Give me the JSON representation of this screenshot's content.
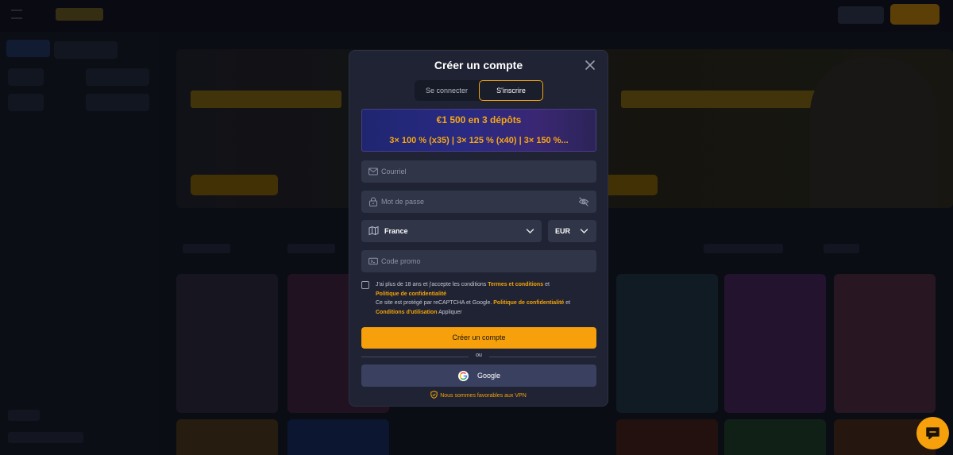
{
  "modal": {
    "title": "Créer un compte",
    "tabs": {
      "login": "Se connecter",
      "register": "S'inscrire",
      "active": "register"
    },
    "promo": {
      "line1": "€1 500 en 3 dépôts",
      "line2": "3× 100 % (x35) | 3× 125 % (x40) | 3× 150 %..."
    },
    "email": {
      "placeholder": "Courriel",
      "value": ""
    },
    "password": {
      "placeholder": "Mot de passe",
      "value": ""
    },
    "country": {
      "selected": "France"
    },
    "currency": {
      "selected": "EUR"
    },
    "promo_code": {
      "placeholder": "Code promo",
      "value": ""
    },
    "consent": {
      "checked": false,
      "age_text": "J'ai plus de 18 ans et j'accepte les conditions",
      "terms_link": "Termes et conditions",
      "and1": "et",
      "privacy_link": "Politique de confidentialité",
      "recaptcha_text": "Ce site est protégé par reCAPTCHA et Google.",
      "privacy_link2": "Politique de confidentialité",
      "and2": "et",
      "terms_of_use_link": "Conditions d'utilisation",
      "apply_text": "Appliquer"
    },
    "create_button": "Créer un compte",
    "or_text": "ou",
    "google_button": "Google",
    "vpn_text": "Nous sommes favorables aux VPN"
  },
  "colors": {
    "accent": "#f6a00b",
    "modal_bg": "#1f2333",
    "field_bg": "#303648",
    "google_bg": "#3a4160"
  },
  "icons": [
    "close-icon",
    "mail-icon",
    "lock-icon",
    "eye-off-icon",
    "map-icon",
    "chevron-down-icon",
    "ticket-icon",
    "google-icon",
    "shield-icon",
    "chat-icon"
  ]
}
